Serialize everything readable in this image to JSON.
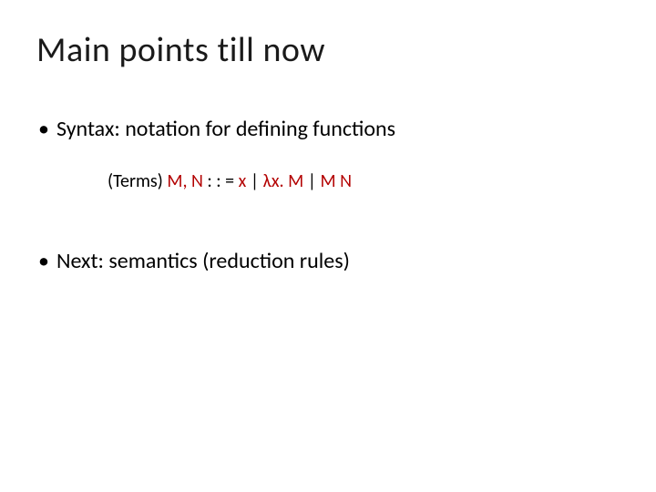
{
  "title": "Main points till now",
  "bullet1": "Syntax: notation for defining functions",
  "grammar": {
    "label": "(Terms)",
    "lhs": "M, N",
    "op": "  : : =",
    "rhs1": "  x",
    "sep1": "  |",
    "rhs2": "  λx. M",
    "sep2": "  |",
    "rhs3": "  M N"
  },
  "bullet2": "Next: semantics (reduction rules)"
}
